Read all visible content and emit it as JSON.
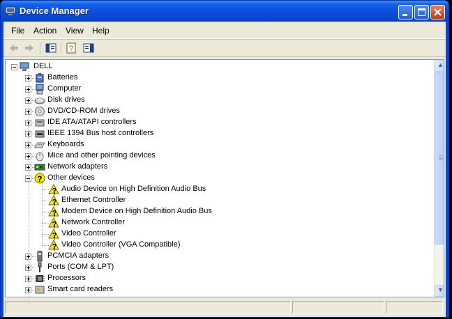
{
  "window": {
    "title": "Device Manager"
  },
  "menubar": {
    "items": [
      "File",
      "Action",
      "View",
      "Help"
    ]
  },
  "tree": {
    "root": "DELL",
    "categories": [
      {
        "label": "Batteries",
        "icon": "battery-icon",
        "expanded": false
      },
      {
        "label": "Computer",
        "icon": "computer-icon",
        "expanded": false
      },
      {
        "label": "Disk drives",
        "icon": "disk-drive-icon",
        "expanded": false
      },
      {
        "label": "DVD/CD-ROM drives",
        "icon": "cdrom-icon",
        "expanded": false
      },
      {
        "label": "IDE ATA/ATAPI controllers",
        "icon": "ide-controller-icon",
        "expanded": false
      },
      {
        "label": "IEEE 1394 Bus host controllers",
        "icon": "firewire-icon",
        "expanded": false
      },
      {
        "label": "Keyboards",
        "icon": "keyboard-icon",
        "expanded": false
      },
      {
        "label": "Mice and other pointing devices",
        "icon": "mouse-icon",
        "expanded": false
      },
      {
        "label": "Network adapters",
        "icon": "network-adapter-icon",
        "expanded": false
      },
      {
        "label": "Other devices",
        "icon": "unknown-device-icon",
        "expanded": true,
        "children": [
          "Audio Device on High Definition Audio Bus",
          "Ethernet Controller",
          "Modem Device on High Definition Audio Bus",
          "Network Controller",
          "Video Controller",
          "Video Controller (VGA Compatible)"
        ]
      },
      {
        "label": "PCMCIA adapters",
        "icon": "pcmcia-icon",
        "expanded": false
      },
      {
        "label": "Ports (COM & LPT)",
        "icon": "port-icon",
        "expanded": false
      },
      {
        "label": "Processors",
        "icon": "processor-icon",
        "expanded": false
      },
      {
        "label": "Smart card readers",
        "icon": "smartcard-icon",
        "expanded": false
      }
    ]
  },
  "colors": {
    "titlebar": "#0a50dc",
    "warning": "#f8e800",
    "face": "#ece9d8"
  }
}
